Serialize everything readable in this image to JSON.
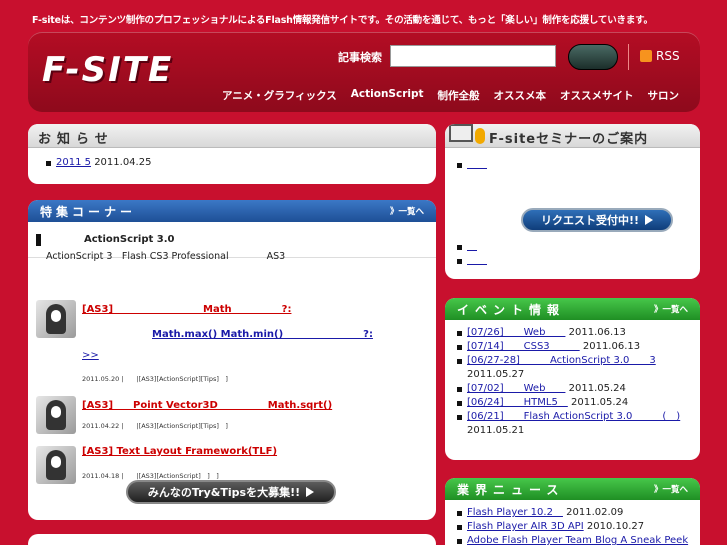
{
  "tagline": "F-siteは、コンテンツ制作のプロフェッショナルによるFlash情報発信サイトです。その活動を通じて、もっと「楽しい」制作を応援していきます。",
  "header": {
    "logo": "F-SITE",
    "search_label": "記事検索",
    "search_value": "",
    "rss_label": "RSS",
    "nav": [
      "アニメ・グラフィックス",
      "ActionScript",
      "制作全般",
      "オススメ本",
      "オススメサイト",
      "サロン"
    ]
  },
  "news": {
    "title": "お知らせ",
    "items": [
      {
        "link": "2011 5",
        "date": "2011.04.25"
      }
    ]
  },
  "feature": {
    "title": "特集コーナー",
    "more": "》一覧へ",
    "intro_title": "ActionScript 3.0",
    "intro_text": "ActionScript 3　Flash CS3 Professional　　　　AS3",
    "articles": [
      {
        "title": "[AS3]　　　　　　　　　Math　　　　　?:",
        "line2": "Math.max() Math.min()　　　　　　　　?:",
        "line3": ">>",
        "meta": "2011.05.20 |　　|[AS3][ActionScript][Tips]　]"
      },
      {
        "title": "[AS3]　　Point  Vector3D　　　　　Math.sqrt()",
        "meta": "2011.04.22 |　　|[AS3][ActionScript][Tips]　]"
      },
      {
        "title": "[AS3] Text Layout Framework(TLF)",
        "meta": "2011.04.18 |　　|[AS3][ActionScript]　]　]"
      }
    ],
    "cta": "みんなのTry&Tipsを大募集!!"
  },
  "seminar": {
    "title": "F-siteセミナーのご案内",
    "cta": "リクエスト受付中!!"
  },
  "events": {
    "title": "イベント情報",
    "more": "》一覧へ",
    "items": [
      {
        "link": "[07/26]　　Web　　",
        "date": "2011.06.13"
      },
      {
        "link": "[07/14]　　CSS3　　　",
        "date": "2011.06.13"
      },
      {
        "link": "[06/27-28]　　　ActionScript 3.0　　3",
        "date": "2011.05.27"
      },
      {
        "link": "[07/02]　　Web　　",
        "date": "2011.05.24"
      },
      {
        "link": "[06/24]　　HTML5　",
        "date": "2011.05.24"
      },
      {
        "link": "[06/21]　　Flash ActionScript 3.0　　　(　)",
        "date": "2011.05.21"
      }
    ]
  },
  "industry": {
    "title": "業界ニュース",
    "more": "》一覧へ",
    "items": [
      {
        "link": "Flash Player 10.2　",
        "date": "2011.02.09"
      },
      {
        "link": "Flash Player AIR 3D API",
        "date": "2010.10.27"
      },
      {
        "link": "Adobe Flash Player Team Blog A Sneak Peek",
        "date": ""
      }
    ]
  }
}
